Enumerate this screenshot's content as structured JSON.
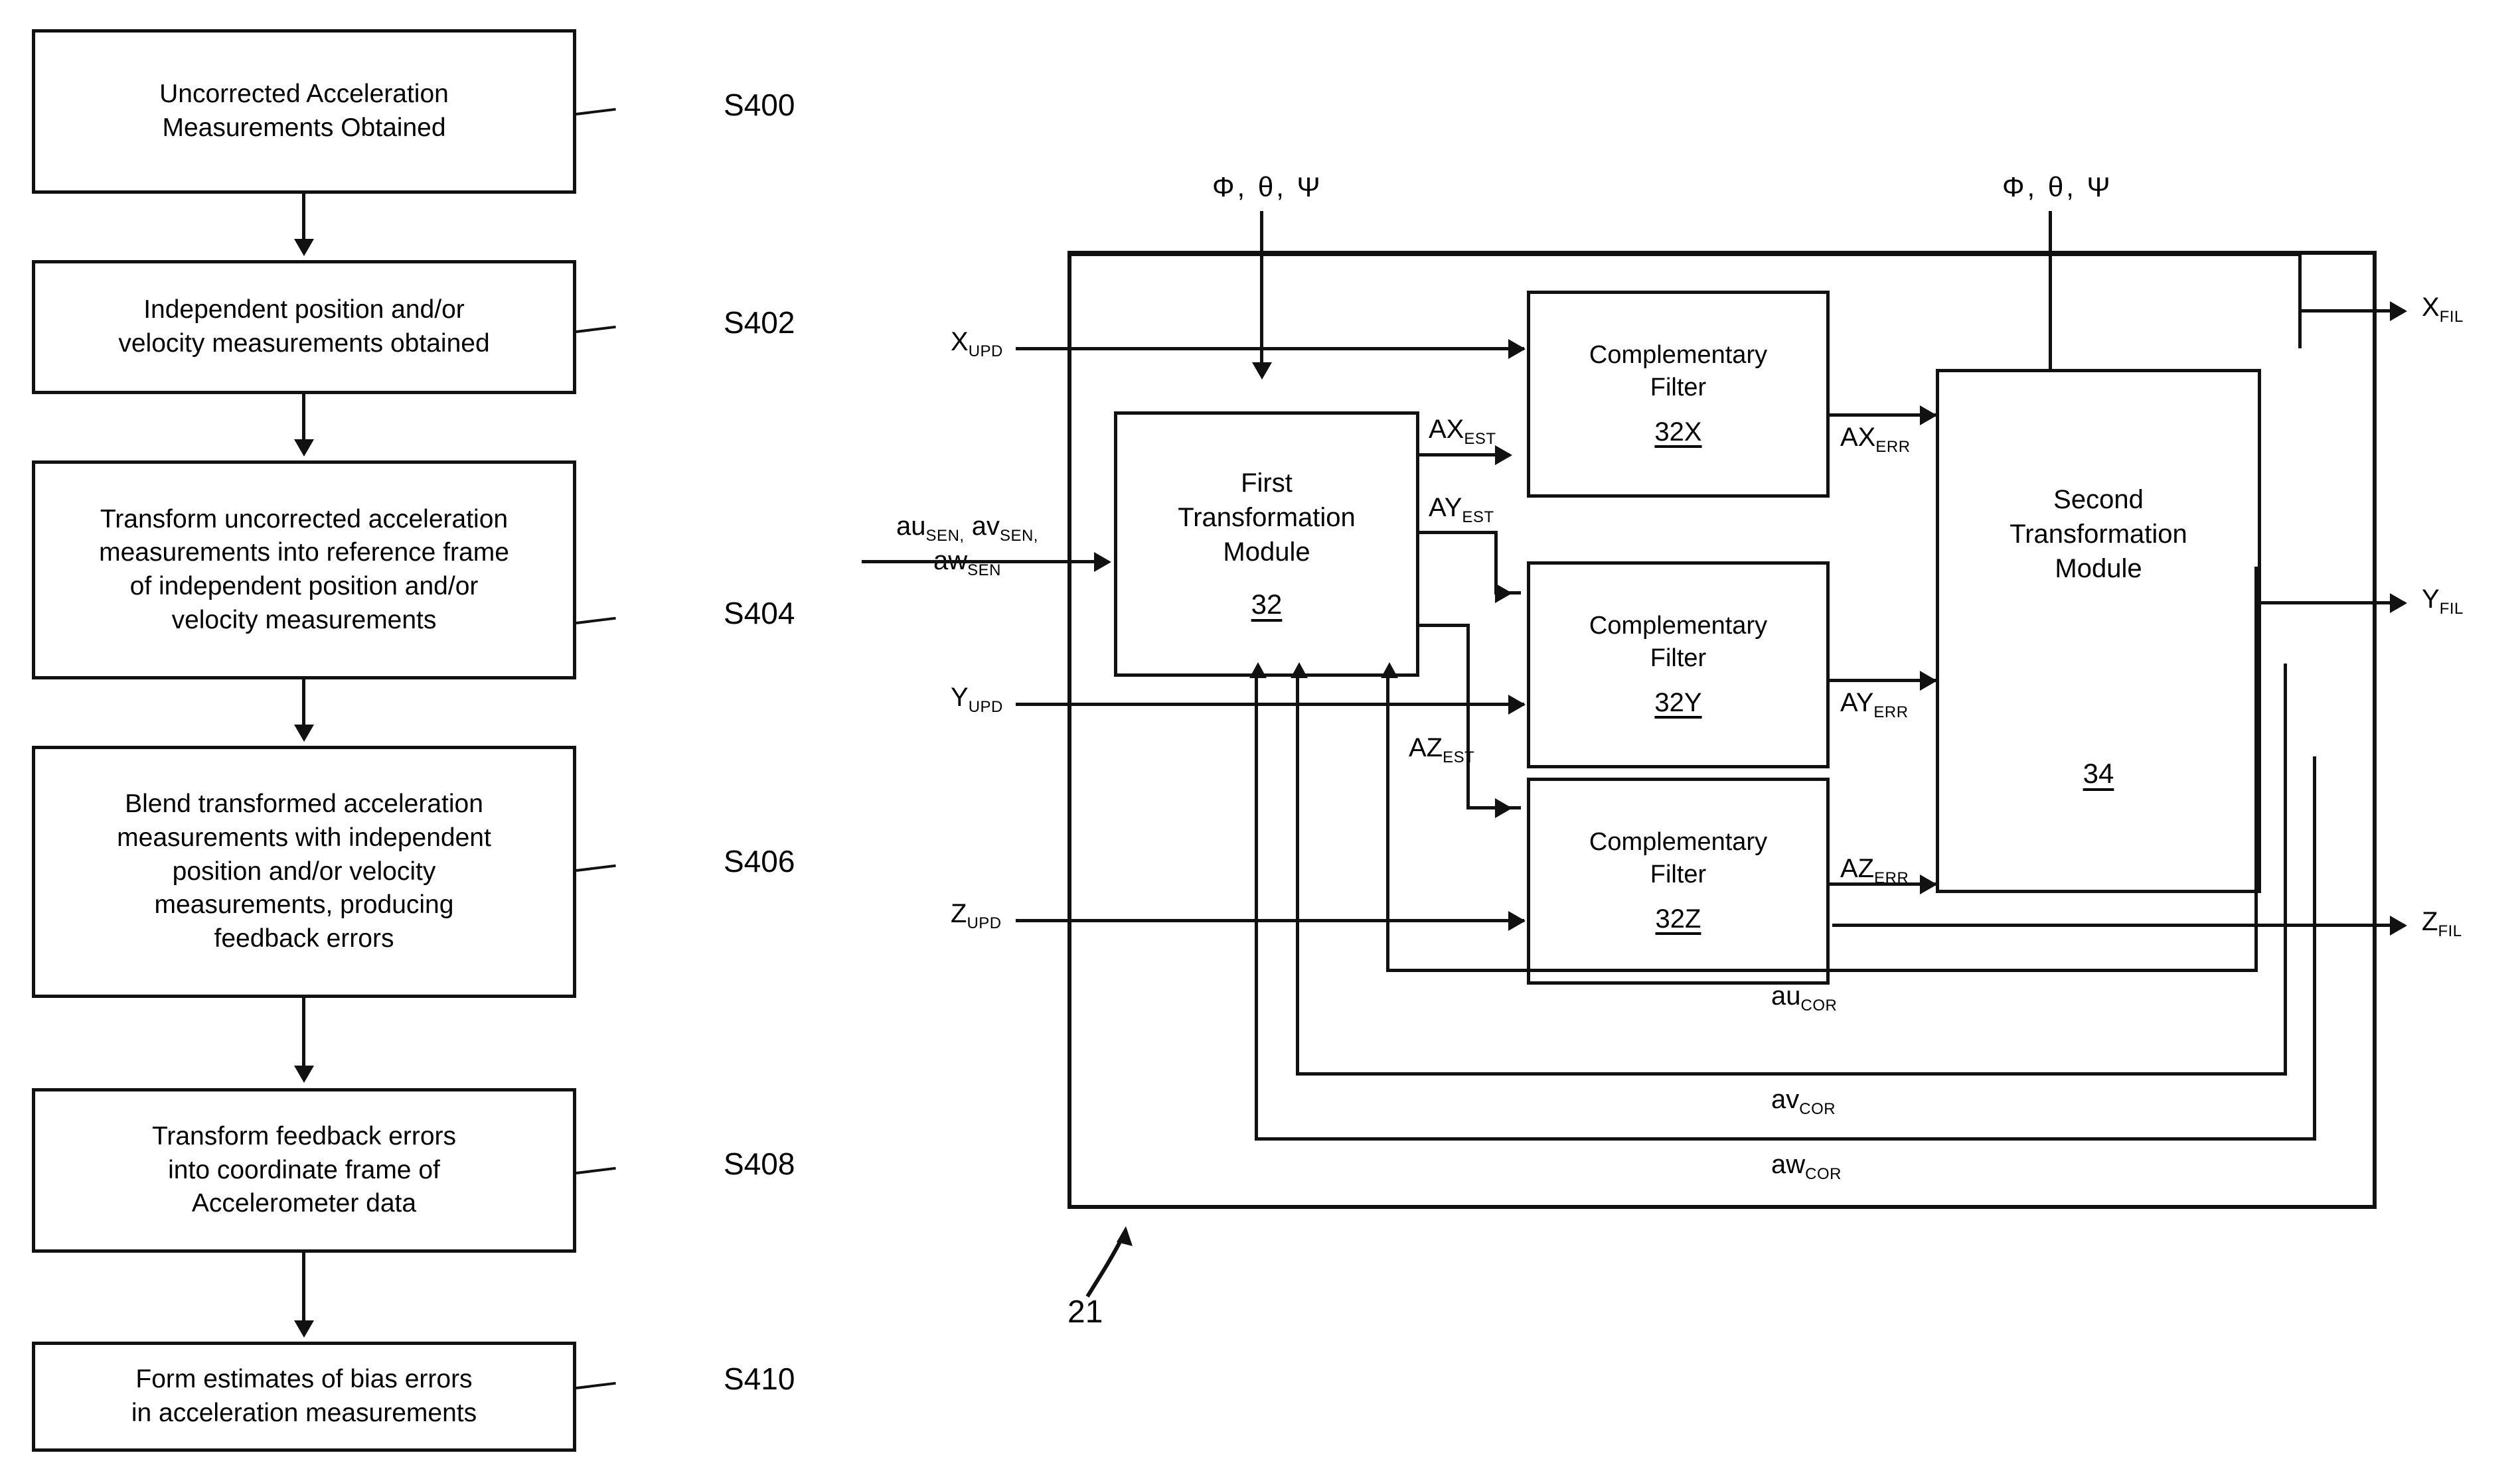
{
  "figure": {
    "flowchart": {
      "steps": [
        {
          "id": "S400",
          "text": "Uncorrected Acceleration\nMeasurements Obtained"
        },
        {
          "id": "S402",
          "text": "Independent position and/or\nvelocity measurements obtained"
        },
        {
          "id": "S404",
          "text": "Transform uncorrected acceleration\nmeasurements into reference frame\nof independent position and/or\nvelocity measurements"
        },
        {
          "id": "S406",
          "text": "Blend transformed acceleration\nmeasurements with independent\nposition and/or velocity\nmeasurements, producing\nfeedback errors"
        },
        {
          "id": "S408",
          "text": "Transform feedback errors\ninto coordinate frame of\nAccelerometer data"
        },
        {
          "id": "S410",
          "text": "Form estimates of bias errors\nin acceleration measurements"
        }
      ]
    },
    "block_diagram": {
      "system_ref": "21",
      "attitude_input_left": "Φ, θ, Ψ",
      "attitude_input_right": "Φ, θ, Ψ",
      "modules": [
        {
          "name": "First\nTransformation\nModule",
          "num": "32"
        },
        {
          "name": "Second\nTransformation\nModule",
          "num": "34"
        }
      ],
      "filters": [
        {
          "name": "Complementary\nFilter",
          "num": "32X"
        },
        {
          "name": "Complementary\nFilter",
          "num": "32Y"
        },
        {
          "name": "Complementary\nFilter",
          "num": "32Z"
        }
      ],
      "inputs": {
        "sensor_accel_line1": "au",
        "sensor_accel_line1_sub": "SEN,",
        "sensor_accel_line1b": "av",
        "sensor_accel_line1b_sub": "SEN,",
        "sensor_accel_line2": "aw",
        "sensor_accel_line2_sub": "SEN",
        "x_upd": "X",
        "x_upd_sub": "UPD",
        "y_upd": "Y",
        "y_upd_sub": "UPD",
        "z_upd": "Z",
        "z_upd_sub": "UPD"
      },
      "estimates": [
        {
          "base": "AX",
          "sub": "EST"
        },
        {
          "base": "AY",
          "sub": "EST"
        },
        {
          "base": "AZ",
          "sub": "EST"
        }
      ],
      "errors": [
        {
          "base": "AX",
          "sub": "ERR"
        },
        {
          "base": "AY",
          "sub": "ERR"
        },
        {
          "base": "AZ",
          "sub": "ERR"
        }
      ],
      "outputs": [
        {
          "base": "X",
          "sub": "FIL"
        },
        {
          "base": "Y",
          "sub": "FIL"
        },
        {
          "base": "Z",
          "sub": "FIL"
        }
      ],
      "corrections": [
        {
          "base": "au",
          "sub": "COR"
        },
        {
          "base": "av",
          "sub": "COR"
        },
        {
          "base": "aw",
          "sub": "COR"
        }
      ]
    }
  }
}
